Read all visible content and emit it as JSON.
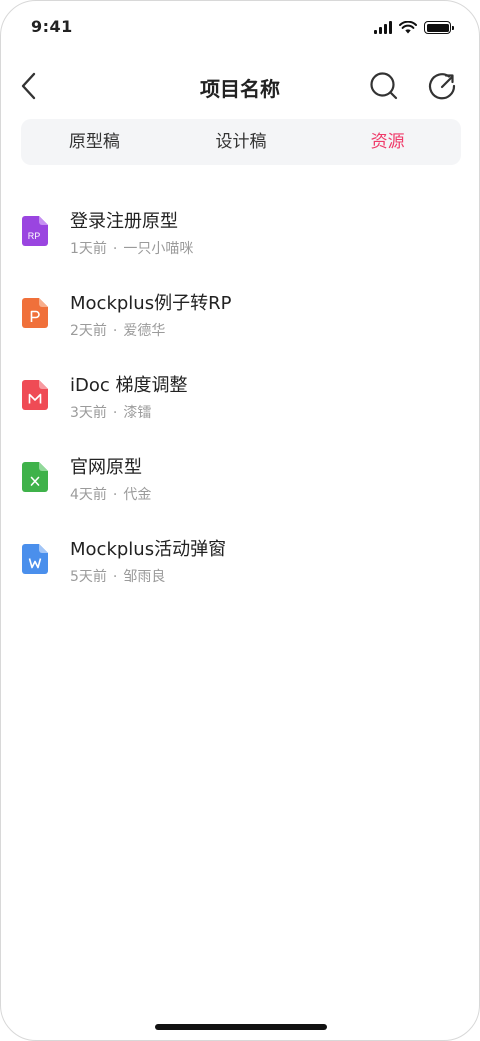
{
  "status_bar": {
    "time": "9:41"
  },
  "nav": {
    "title": "项目名称",
    "back_icon": "chevron-left-icon",
    "search_icon": "search-icon",
    "share_icon": "share-icon"
  },
  "tabs": [
    {
      "label": "原型稿",
      "active": false
    },
    {
      "label": "设计稿",
      "active": false
    },
    {
      "label": "资源",
      "active": true
    }
  ],
  "colors": {
    "accent": "#ef3b6a",
    "tab_bg": "#f4f5f7",
    "meta_text": "#9b9b9b"
  },
  "files": [
    {
      "name": "登录注册原型",
      "time": "1天前",
      "author": "一只小喵咪",
      "icon": "rp-file-icon",
      "icon_color": "#9a45e0",
      "icon_glyph": "RP"
    },
    {
      "name": "Mockplus例子转RP",
      "time": "2天前",
      "author": "爱德华",
      "icon": "powerpoint-file-icon",
      "icon_color": "#f0703a",
      "icon_glyph": "P"
    },
    {
      "name": "iDoc 梯度调整",
      "time": "3天前",
      "author": "漆镭",
      "icon": "mockplus-file-icon",
      "icon_color": "#ef4b55",
      "icon_glyph": "M"
    },
    {
      "name": "官网原型",
      "time": "4天前",
      "author": "代金",
      "icon": "excel-file-icon",
      "icon_color": "#3fb24a",
      "icon_glyph": "×"
    },
    {
      "name": "Mockplus活动弹窗",
      "time": "5天前",
      "author": "邹雨良",
      "icon": "word-file-icon",
      "icon_color": "#4a8fec",
      "icon_glyph": "W"
    }
  ]
}
